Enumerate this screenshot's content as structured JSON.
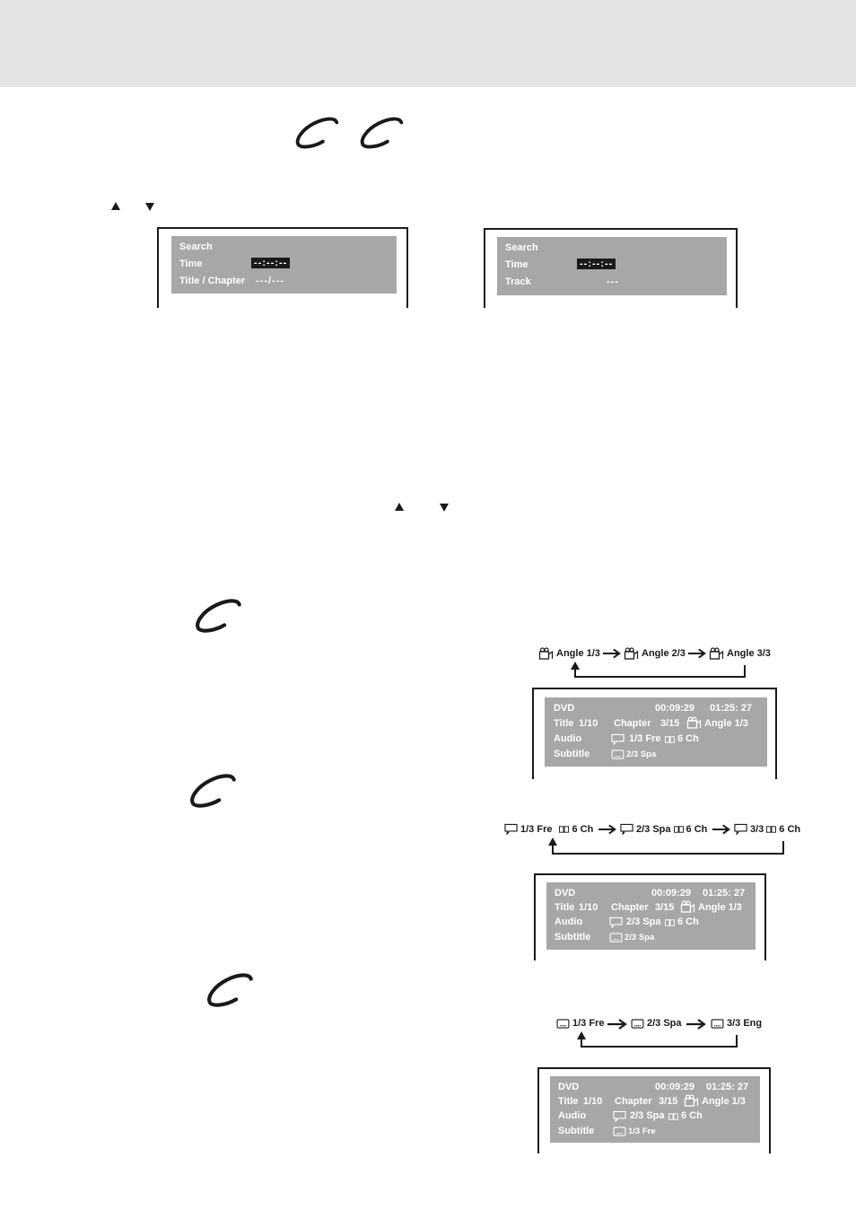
{
  "page": {
    "header_band_color": "#e3e3e3",
    "osd_panel_color": "#a8a7a7"
  },
  "nav_keys": {
    "up_icon": "up-triangle-icon",
    "down_icon": "down-triangle-icon"
  },
  "search_screens": [
    {
      "title": "Search",
      "rows": [
        {
          "label": "Time",
          "value": "--:--:--",
          "highlighted": true
        },
        {
          "label": "Title / Chapter",
          "value": "---/---",
          "highlighted": false
        }
      ]
    },
    {
      "title": "Search",
      "rows": [
        {
          "label": "Time",
          "value": "--:--:--",
          "highlighted": true
        },
        {
          "label": "Track",
          "value": "---",
          "highlighted": false
        }
      ]
    }
  ],
  "angle_flow": {
    "items": [
      "Angle 1/3",
      "Angle 2/3",
      "Angle 3/3"
    ],
    "icon": "camera-icon"
  },
  "audio_flow": {
    "items": [
      "1/3 Fre",
      "2/3 Spa",
      "3/3"
    ],
    "suffix": "6 Ch",
    "icon": "speech-bubble-icon",
    "dolby_icon": "dolby-icon"
  },
  "subtitle_flow": {
    "items": [
      "1/3 Fre",
      "2/3 Spa",
      "3/3 Eng"
    ],
    "icon": "subtitle-box-icon"
  },
  "info_screens": [
    {
      "disc": "DVD",
      "elapsed": "00:09:29",
      "total": "01:25: 27",
      "title_label": "Title",
      "title_value": "1/10",
      "chapter_label": "Chapter",
      "chapter_value": "3/15",
      "angle": "Angle 1/3",
      "audio_label": "Audio",
      "audio_value": "1/3 Fre",
      "audio_channels": "6 Ch",
      "subtitle_label": "Subtitle",
      "subtitle_value": "2/3 Spa"
    },
    {
      "disc": "DVD",
      "elapsed": "00:09:29",
      "total": "01:25: 27",
      "title_label": "Title",
      "title_value": "1/10",
      "chapter_label": "Chapter",
      "chapter_value": "3/15",
      "angle": "Angle 1/3",
      "audio_label": "Audio",
      "audio_value": "2/3 Spa",
      "audio_channels": "6 Ch",
      "subtitle_label": "Subtitle",
      "subtitle_value": "2/3 Spa"
    },
    {
      "disc": "DVD",
      "elapsed": "00:09:29",
      "total": "01:25: 27",
      "title_label": "Title",
      "title_value": "1/10",
      "chapter_label": "Chapter",
      "chapter_value": "3/15",
      "angle": "Angle 1/3",
      "audio_label": "Audio",
      "audio_value": "2/3 Spa",
      "audio_channels": "6 Ch",
      "subtitle_label": "Subtitle",
      "subtitle_value": "1/3 Fre"
    }
  ]
}
